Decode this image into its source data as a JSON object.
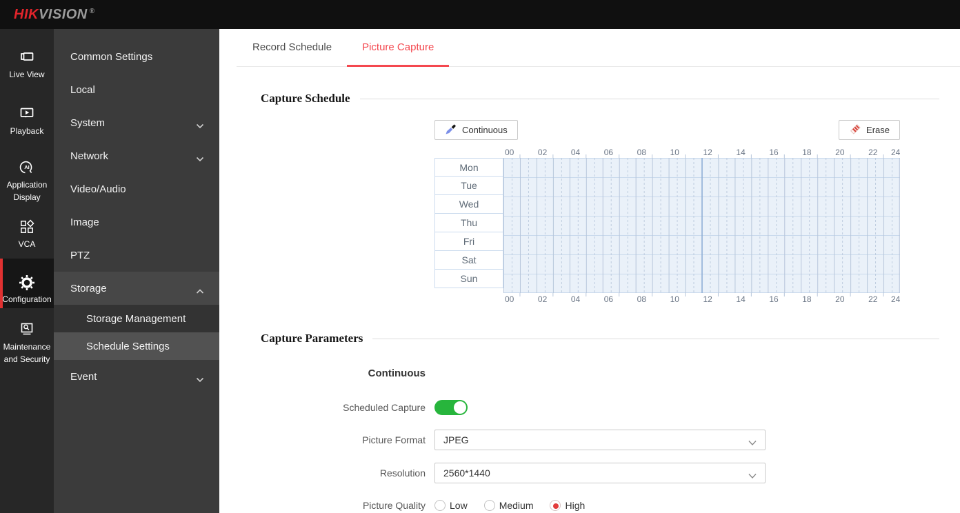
{
  "topbar": {
    "logo": {
      "hik": "HIK",
      "vision": "VISION",
      "registered": "®"
    }
  },
  "nav_rail": {
    "items": [
      {
        "id": "live-view",
        "label": "Live View",
        "icon": "live-view-icon",
        "active": false
      },
      {
        "id": "playback",
        "label": "Playback",
        "icon": "playback-icon",
        "active": false
      },
      {
        "id": "application-display",
        "label": "Application Display",
        "icon": "ai-head-icon",
        "active": false
      },
      {
        "id": "vca",
        "label": "VCA",
        "icon": "vca-shapes-icon",
        "active": false
      },
      {
        "id": "configuration",
        "label": "Configuration",
        "icon": "gear-icon",
        "active": true
      },
      {
        "id": "maintenance-and-security",
        "label": "Maintenance and Security",
        "icon": "maintenance-icon",
        "active": false
      }
    ]
  },
  "submenu": {
    "items": [
      {
        "id": "common-settings",
        "label": "Common Settings",
        "type": "top"
      },
      {
        "id": "local",
        "label": "Local",
        "type": "top"
      },
      {
        "id": "system",
        "label": "System",
        "type": "top",
        "chevron": "down"
      },
      {
        "id": "network",
        "label": "Network",
        "type": "top",
        "chevron": "down"
      },
      {
        "id": "video-audio",
        "label": "Video/Audio",
        "type": "top"
      },
      {
        "id": "image",
        "label": "Image",
        "type": "top"
      },
      {
        "id": "ptz",
        "label": "PTZ",
        "type": "top"
      },
      {
        "id": "storage",
        "label": "Storage",
        "type": "top",
        "chevron": "up",
        "state": "expanded"
      },
      {
        "id": "storage-management",
        "label": "Storage Management",
        "type": "sub"
      },
      {
        "id": "schedule-settings",
        "label": "Schedule Settings",
        "type": "sub",
        "state": "selected"
      },
      {
        "id": "event",
        "label": "Event",
        "type": "top",
        "chevron": "down"
      }
    ]
  },
  "main": {
    "tabs": [
      {
        "id": "record-schedule",
        "label": "Record Schedule",
        "active": false
      },
      {
        "id": "picture-capture",
        "label": "Picture Capture",
        "active": true
      }
    ],
    "capture_schedule": {
      "heading": "Capture Schedule",
      "continuous_button": "Continuous",
      "erase_button": "Erase",
      "days": [
        "Mon",
        "Tue",
        "Wed",
        "Thu",
        "Fri",
        "Sat",
        "Sun"
      ],
      "hour_tick_labels": [
        "00",
        "02",
        "04",
        "06",
        "08",
        "10",
        "12",
        "14",
        "16",
        "18",
        "20",
        "22",
        "24"
      ],
      "schedule_type": "Continuous",
      "scheduled_ranges": "00:00-24:00 on all seven days"
    },
    "capture_parameters": {
      "heading": "Capture Parameters",
      "group_title": "Continuous",
      "scheduled_capture": {
        "label": "Scheduled Capture",
        "value": "on"
      },
      "picture_format": {
        "label": "Picture Format",
        "value": "JPEG"
      },
      "resolution": {
        "label": "Resolution",
        "value": "2560*1440"
      },
      "picture_quality": {
        "label": "Picture Quality",
        "options": [
          {
            "label": "Low",
            "selected": false
          },
          {
            "label": "Medium",
            "selected": false
          },
          {
            "label": "High",
            "selected": true
          }
        ]
      }
    }
  },
  "colors": {
    "accent_red": "#f4484f",
    "logo_red": "#e2242b",
    "active_marker_red": "#e03131",
    "toggle_green": "#27b53c",
    "radio_red": "#e23b3b",
    "schedule_fill": "#eaf1f9",
    "schedule_line": "#b7c6db",
    "schedule_line_strong": "#8fafd6",
    "schedule_row_line": "#c9d9ec",
    "sidebar_bg": "#272727",
    "submenu_bg": "#3b3b3b"
  }
}
